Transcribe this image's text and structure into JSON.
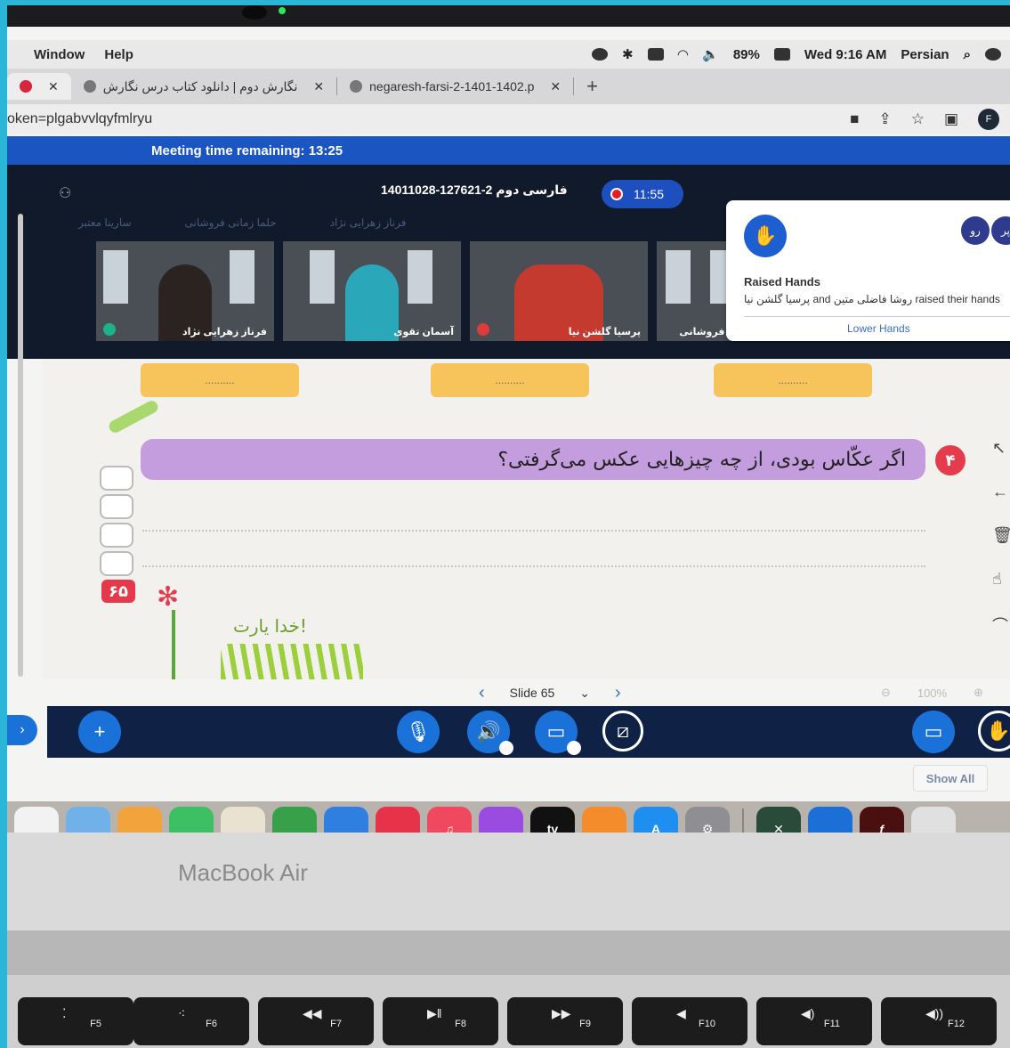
{
  "menubar": {
    "menus": [
      "Window",
      "Help"
    ],
    "battery": "89%",
    "clock": "Wed 9:16 AM",
    "input_lang": "Persian"
  },
  "tabs": [
    {
      "title": "",
      "active": true
    },
    {
      "title": "نگارش دوم | دانلود کتاب درس نگارش",
      "active": false
    },
    {
      "title": "negaresh-farsi-2-1401-1402.p",
      "active": false
    }
  ],
  "address": {
    "url": "oken=plgabvvlqyfmlryu",
    "profile_initial": "F"
  },
  "meeting": {
    "time_remaining": "Meeting time remaining: 13:25",
    "title": "14011028-127621-2 فارسی دوم",
    "recording_time": "11:55",
    "faded_names": [
      "سارینا معتبر",
      "حلما زمانی فروشانی",
      "فرناز زهرایی نژاد"
    ],
    "tiles": [
      {
        "name": "فرناز زهرایی نژاد"
      },
      {
        "name": "آسمان تقوی"
      },
      {
        "name": "پرسیا گلشن نیا"
      },
      {
        "name": "زمانی فروشانی"
      }
    ]
  },
  "raised_hands": {
    "avatars": [
      "پر",
      "رو"
    ],
    "title": "Raised Hands",
    "text": "پرسیا گلشن نیا and روشا فاضلی متین raised their hands",
    "lower_label": "Lower Hands"
  },
  "slide": {
    "placeholder": "..........",
    "question_number": "۴",
    "question": "اگر عکّاس بودی، از چه چیزهایی عکس می‌گرفتی؟",
    "page_number": "۶۵",
    "closing_text": "خدا یارت!"
  },
  "slide_nav": {
    "label": "Slide 65",
    "zoom": "100%"
  },
  "show_all": "Show All",
  "dock_labels": {
    "appletv": "tv"
  },
  "brand": "MacBook Air",
  "keys": [
    {
      "fn": "F5"
    },
    {
      "fn": "F6"
    },
    {
      "fn": "F7"
    },
    {
      "fn": "F8"
    },
    {
      "fn": "F9"
    },
    {
      "fn": "F10"
    },
    {
      "fn": "F11"
    },
    {
      "fn": "F12"
    }
  ]
}
